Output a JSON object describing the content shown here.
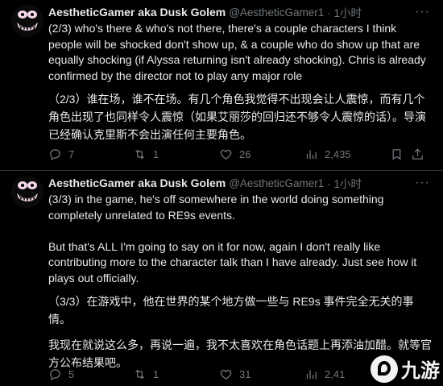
{
  "tweets": [
    {
      "author": {
        "name": "AestheticGamer aka Dusk Golem",
        "handle": "@AestheticGamer1",
        "time": "· 1小时"
      },
      "en": "(2/3) who's there & who's not there, there's a couple characters I think\npeople will be shocked don't show up, & a couple who do show up that are\nequally shocking (if Alyssa returning isn't already shocking). Chris is already\nconfirmed by the director not to play any major role",
      "zh": "（2/3）谁在场，谁不在场。有几个角色我觉得不出现会让人震惊，而有几个\n角色出现了也同样令人震惊（如果艾丽莎的回归还不够令人震惊的话）。导演\n已经确认克里斯不会出演任何主要角色。",
      "stats": {
        "replies": "7",
        "retweets": "1",
        "likes": "26",
        "views": "2,435"
      }
    },
    {
      "author": {
        "name": "AestheticGamer aka Dusk Golem",
        "handle": "@AestheticGamer1",
        "time": "· 1小时"
      },
      "en": "(3/3) in the game, he's off somewhere in the world doing something\ncompletely unrelated to RE9s events.\n\nBut that's ALL I'm going to say on it for now, again I don't really like\ncontributing more to the character talk than I have already. Just see how it\nplays out officially.",
      "zh": "（3/3）在游戏中，他在世界的某个地方做一些与 RE9s 事件完全无关的事情。",
      "zh2": "我现在就说这么多，再说一遍，我不太喜欢在角色话题上再添油加醋。就等官\n方公布结果吧。",
      "stats": {
        "replies": "5",
        "retweets": "1",
        "likes": "31",
        "views": "2,41"
      }
    }
  ],
  "more_label": "···",
  "watermark": "九游",
  "colors": {
    "background": "#000000",
    "text": "#e7e9ea",
    "muted": "#71767b",
    "divider": "#2f3336"
  }
}
